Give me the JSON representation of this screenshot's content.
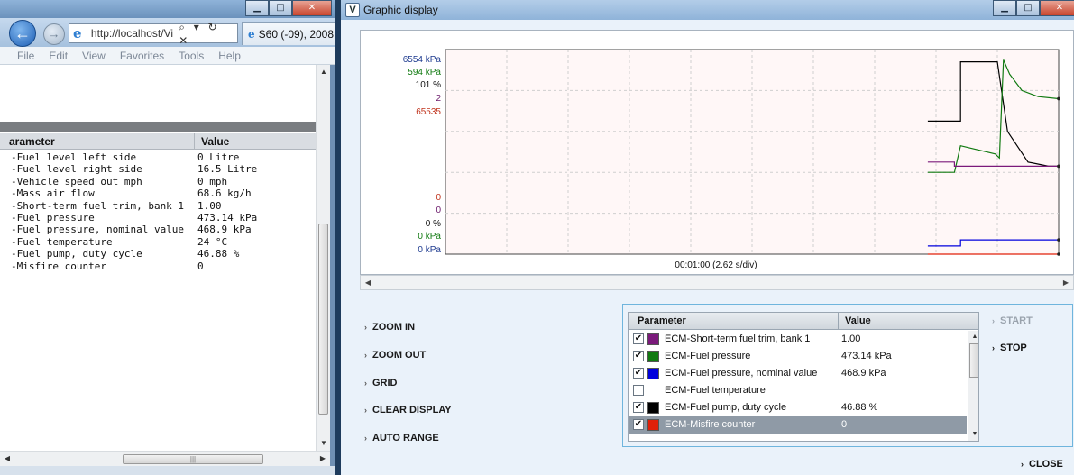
{
  "ie": {
    "address_url": "http://localhost/Vi",
    "address_icons": "⌕ ▾ ↻ ✕",
    "tab_label": "S60 (-09), 2008,",
    "menu": [
      "File",
      "Edit",
      "View",
      "Favorites",
      "Tools",
      "Help"
    ],
    "table": {
      "col_parameter": "arameter",
      "col_value": "Value",
      "rows": [
        {
          "name": "-Fuel level left side",
          "value": "0 Litre"
        },
        {
          "name": "-Fuel level right side",
          "value": "16.5 Litre"
        },
        {
          "name": "-Vehicle speed out mph",
          "value": "0 mph"
        },
        {
          "name": "-Mass air flow",
          "value": "68.6 kg/h"
        },
        {
          "name": "-Short-term fuel trim, bank 1",
          "value": "1.00"
        },
        {
          "name": "-Fuel pressure",
          "value": "473.14 kPa"
        },
        {
          "name": "-Fuel pressure, nominal value",
          "value": "468.9 kPa"
        },
        {
          "name": "-Fuel temperature",
          "value": "24 °C"
        },
        {
          "name": "-Fuel pump, duty cycle",
          "value": "46.88 %"
        },
        {
          "name": "-Misfire counter",
          "value": "0"
        }
      ]
    }
  },
  "graphic": {
    "title": "Graphic display",
    "controls": {
      "zoom_in": "ZOOM IN",
      "zoom_out": "ZOOM OUT",
      "grid": "GRID",
      "clear_display": "CLEAR DISPLAY",
      "auto_range": "AUTO RANGE",
      "start": "START",
      "stop": "STOP",
      "close": "CLOSE"
    },
    "table": {
      "col_parameter": "Parameter",
      "col_value": "Value",
      "rows": [
        {
          "name": "ECM-Short-term fuel trim, bank 1",
          "value": "1.00",
          "color": "#7b1a7b",
          "checked": true,
          "selected": false
        },
        {
          "name": "ECM-Fuel pressure",
          "value": "473.14 kPa",
          "color": "#117a11",
          "checked": true,
          "selected": false
        },
        {
          "name": "ECM-Fuel pressure, nominal value",
          "value": "468.9 kPa",
          "color": "#0000dd",
          "checked": true,
          "selected": false
        },
        {
          "name": "ECM-Fuel temperature",
          "value": "",
          "color": "",
          "checked": false,
          "selected": false
        },
        {
          "name": "ECM-Fuel pump, duty cycle",
          "value": "46.88 %",
          "color": "#000000",
          "checked": true,
          "selected": false
        },
        {
          "name": "ECM-Misfire counter",
          "value": "0",
          "color": "#e0200a",
          "checked": true,
          "selected": true
        }
      ]
    }
  },
  "chart_data": {
    "type": "line",
    "xlabel": "00:01:00 (2.62 s/div)",
    "y_top_labels": [
      {
        "text": "6554 kPa",
        "color": "#1d3a8f"
      },
      {
        "text": "594 kPa",
        "color": "#117a11"
      },
      {
        "text": "101 %",
        "color": "#111111"
      },
      {
        "text": "2",
        "color": "#6b1a6b"
      },
      {
        "text": "65535",
        "color": "#c0341d"
      }
    ],
    "y_bottom_labels": [
      {
        "text": "0",
        "color": "#c0341d"
      },
      {
        "text": "0",
        "color": "#6b1a6b"
      },
      {
        "text": "0 %",
        "color": "#111111"
      },
      {
        "text": "0 kPa",
        "color": "#117a11"
      },
      {
        "text": "0 kPa",
        "color": "#1d3a8f"
      }
    ],
    "grid": true,
    "x_range": [
      0,
      30
    ],
    "y_range": [
      0,
      100
    ],
    "series": [
      {
        "name": "ECM-Fuel pump, duty cycle",
        "color": "#000000",
        "x": [
          23.6,
          25.2,
          25.2,
          27.0,
          27.5,
          28.5,
          29.5,
          30
        ],
        "y": [
          65,
          65,
          94,
          94,
          60,
          45,
          43,
          43
        ]
      },
      {
        "name": "ECM-Fuel pressure",
        "color": "#117a11",
        "x": [
          23.6,
          24.9,
          25.2,
          26.9,
          27.1,
          27.3,
          27.6,
          28.2,
          29.0,
          30
        ],
        "y": [
          40,
          40,
          53,
          49,
          47,
          95,
          88,
          80,
          77,
          76
        ]
      },
      {
        "name": "ECM-Short-term fuel trim, bank 1",
        "color": "#7b1a7b",
        "x": [
          23.6,
          24.9,
          24.9,
          30
        ],
        "y": [
          45,
          45,
          43,
          43
        ]
      },
      {
        "name": "ECM-Fuel pressure, nominal value",
        "color": "#0000dd",
        "x": [
          23.6,
          25.2,
          25.2,
          30
        ],
        "y": [
          4,
          4,
          7,
          7
        ]
      },
      {
        "name": "ECM-Misfire counter",
        "color": "#e0200a",
        "x": [
          23.6,
          30
        ],
        "y": [
          0,
          0
        ]
      }
    ]
  }
}
